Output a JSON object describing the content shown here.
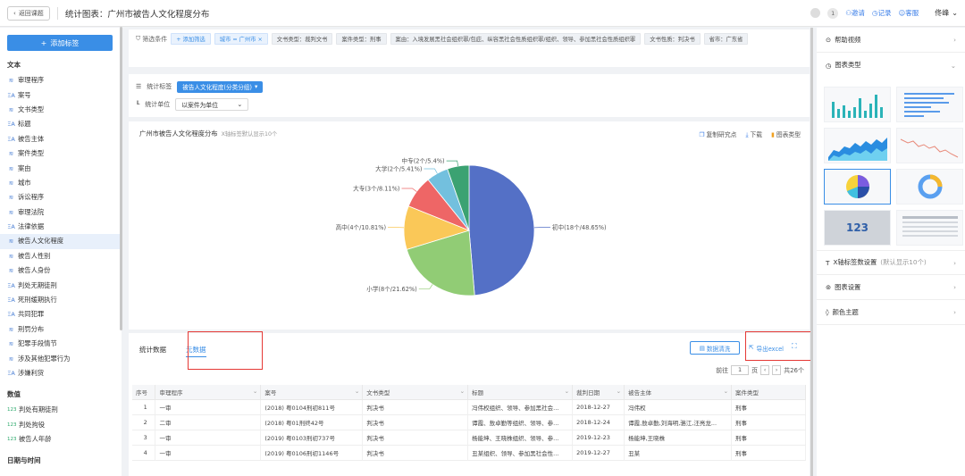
{
  "header": {
    "back_label": "返回课题",
    "title": "统计图表：广州市被告人文化程度分布",
    "notif_count": "1",
    "invite": "邀请",
    "record": "记录",
    "service": "客服",
    "user": "佟峰"
  },
  "sidebar": {
    "add_tag": "添加标签",
    "groups": [
      {
        "title": "文本",
        "items": [
          {
            "icon": "≋",
            "label": "审理程序"
          },
          {
            "icon": "ΞA",
            "label": "案号"
          },
          {
            "icon": "≋",
            "label": "文书类型"
          },
          {
            "icon": "ΞA",
            "label": "标题"
          },
          {
            "icon": "ΞA",
            "label": "被告主体"
          },
          {
            "icon": "≋",
            "label": "案件类型"
          },
          {
            "icon": "≋",
            "label": "案由"
          },
          {
            "icon": "≋",
            "label": "城市"
          },
          {
            "icon": "≋",
            "label": "诉讼程序"
          },
          {
            "icon": "≋",
            "label": "审理法院"
          },
          {
            "icon": "ΞA",
            "label": "法律依据"
          },
          {
            "icon": "≋",
            "label": "被告人文化程度",
            "active": true
          },
          {
            "icon": "≋",
            "label": "被告人性别"
          },
          {
            "icon": "≋",
            "label": "被告人身份"
          },
          {
            "icon": "ΞA",
            "label": "判处无期徒刑"
          },
          {
            "icon": "ΞA",
            "label": "死刑缓期执行"
          },
          {
            "icon": "ΞA",
            "label": "共同犯罪"
          },
          {
            "icon": "≋",
            "label": "刑罚分布"
          },
          {
            "icon": "≋",
            "label": "犯罪手段情节"
          },
          {
            "icon": "≋",
            "label": "涉及其他犯罪行为"
          },
          {
            "icon": "ΞA",
            "label": "涉嫌利货"
          }
        ]
      },
      {
        "title": "数值",
        "items": [
          {
            "icon": "123",
            "label": "判处有期徒刑"
          },
          {
            "icon": "123",
            "label": "判处拘役"
          },
          {
            "icon": "123",
            "label": "被告人年龄"
          }
        ]
      },
      {
        "title": "日期与时间",
        "items": []
      }
    ]
  },
  "filters": {
    "label": "筛选条件",
    "add": "+ 添加筛选",
    "chips": [
      {
        "text": "城市 = 广州市 ×",
        "blue": true
      },
      {
        "text": "文书类型：裁判文书"
      },
      {
        "text": "案件类型：刑事"
      },
      {
        "text": "案由：入境发展黑社会组织罪/包庇、纵容黑社会性质组织罪/组织、领导、参加黑社会性质组织罪"
      },
      {
        "text": "文书性质：判决书"
      },
      {
        "text": "省市：广东省"
      }
    ]
  },
  "stat": {
    "tag_label": "统计标签",
    "tag_value": "被告人文化程度(分类分组)",
    "unit_label": "统计单位",
    "unit_value": "以案件为单位"
  },
  "chart_header": {
    "title": "广州市被告人文化程度分布",
    "subtitle": "X轴标签默认显示10个",
    "copy": "复制研究点",
    "download": "下载",
    "chart_type": "图表类型"
  },
  "chart_data": {
    "type": "pie",
    "title": "广州市被告人文化程度分布",
    "slices": [
      {
        "name": "初中",
        "value": 18,
        "percent": 48.65,
        "label": "初中(18个/48.65%)",
        "color": "#5470c6"
      },
      {
        "name": "小学",
        "value": 8,
        "percent": 21.62,
        "label": "小学(8个/21.62%)",
        "color": "#91cc75"
      },
      {
        "name": "高中",
        "value": 4,
        "percent": 10.81,
        "label": "高中(4个/10.81%)",
        "color": "#fac858"
      },
      {
        "name": "大专",
        "value": 3,
        "percent": 8.11,
        "label": "大专(3个/8.11%)",
        "color": "#ee6666"
      },
      {
        "name": "大学",
        "value": 2,
        "percent": 5.41,
        "label": "大学(2个/5.41%)",
        "color": "#73c0de"
      },
      {
        "name": "中专",
        "value": 2,
        "percent": 5.4,
        "label": "中专(2个/5.4%)",
        "color": "#3ba272"
      }
    ]
  },
  "data_section": {
    "tab_stats": "统计数据",
    "tab_raw": "元数据",
    "clean": "数据清洗",
    "export": "导出excel",
    "pager_prefix": "前往",
    "page": "1",
    "pager_page": "页",
    "total": "共26个",
    "columns": [
      "序号",
      "审理程序",
      "案号",
      "文书类型",
      "标题",
      "裁判日期",
      "被告主体",
      "案件类型"
    ],
    "rows": [
      [
        "1",
        "一审",
        "(2018) 粤0104刑初811号",
        "判决书",
        "冯伟权组织、领导、参加黑社会...",
        "2018-12-27",
        "冯伟权",
        "刑事"
      ],
      [
        "2",
        "二审",
        "(2018) 粤01刑终42号",
        "判决书",
        "谭霞、敖卓勤等组织、领导、参...",
        "2018-12-24",
        "谭霞,敖卓勤,刘海明,骆江,汪亮龙...",
        "刑事"
      ],
      [
        "3",
        "一审",
        "(2019) 粤0103刑初737号",
        "判决书",
        "杨能坤、王晓株组织、领导、参...",
        "2019-12-23",
        "杨能坤,王晓株",
        "刑事"
      ],
      [
        "4",
        "一审",
        "(2019) 粤0106刑初1146号",
        "判决书",
        "丑某组织、领导、参加黑社会性...",
        "2019-12-27",
        "丑某",
        "刑事"
      ]
    ]
  },
  "right_panel": {
    "help": "帮助视频",
    "chart_types": "图表类型",
    "xaxis": "X轴标签数设置",
    "xaxis_hint": "(默认显示10个)",
    "chart_settings": "图表设置",
    "color_theme": "颜色主题",
    "number_thumb": "123"
  }
}
